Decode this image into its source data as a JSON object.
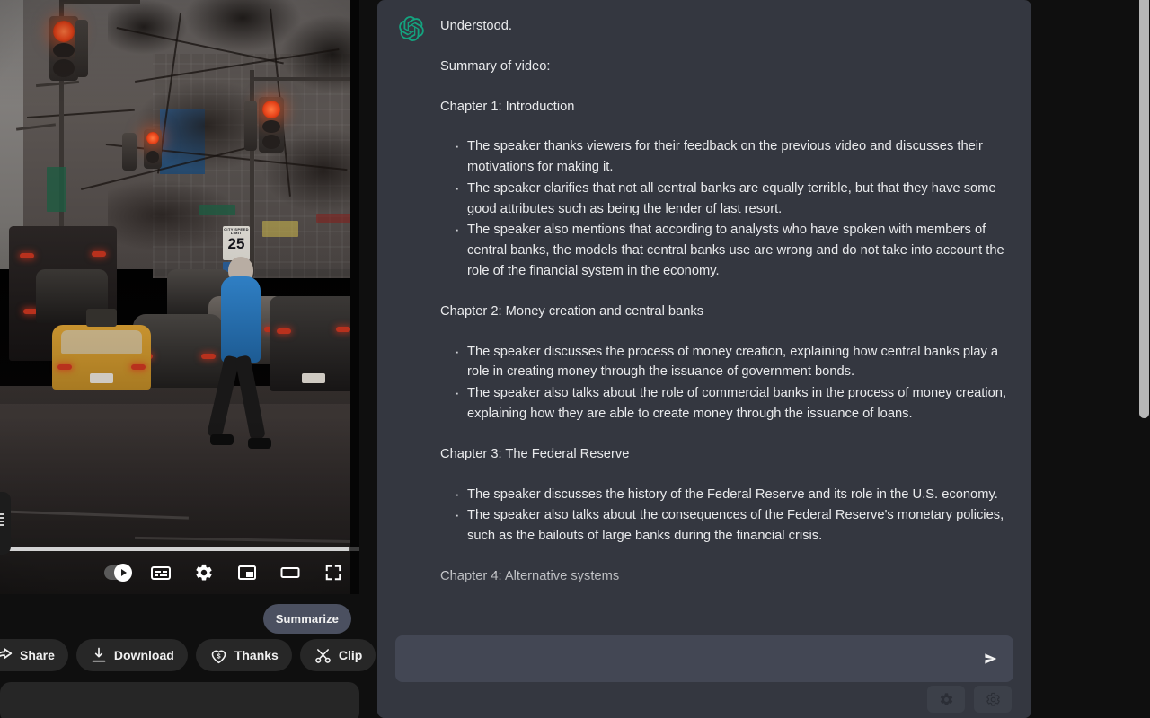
{
  "video_player": {
    "scene_description": "City street at dusk with traffic lights, line of cars including a yellow taxi, and a pedestrian in a blue jacket crossing",
    "speed_limit_sign": "25",
    "speed_limit_caption": "CITY SPEED LIMIT",
    "progress_percent": 97,
    "controls": [
      {
        "name": "autoplay-toggle",
        "label": "Autoplay",
        "state": "on"
      },
      {
        "name": "subtitles-button",
        "label": "Subtitles/closed captions"
      },
      {
        "name": "settings-button",
        "label": "Settings"
      },
      {
        "name": "miniplayer-button",
        "label": "Miniplayer"
      },
      {
        "name": "theater-button",
        "label": "Theater mode"
      },
      {
        "name": "fullscreen-button",
        "label": "Full screen"
      }
    ]
  },
  "summarize": {
    "label": "Summarize"
  },
  "actions": [
    {
      "name": "share",
      "label": "Share",
      "icon": "share-icon"
    },
    {
      "name": "download",
      "label": "Download",
      "icon": "download-icon"
    },
    {
      "name": "thanks",
      "label": "Thanks",
      "icon": "heart-dollar-icon"
    },
    {
      "name": "clip",
      "label": "Clip",
      "icon": "scissors-icon"
    },
    {
      "name": "more",
      "label": "",
      "icon": "more-horizontal-icon"
    }
  ],
  "chat": {
    "avatar_icon": "openai-logo-icon",
    "avatar_color": "#10a37f",
    "intro": "Understood.",
    "summary_heading": "Summary of video:",
    "chapters": [
      {
        "title": "Chapter 1: Introduction",
        "bullets": [
          "The speaker thanks viewers for their feedback on the previous video and discusses their motivations for making it.",
          "The speaker clarifies that not all central banks are equally terrible, but that they have some good attributes such as being the lender of last resort.",
          "The speaker also mentions that according to analysts who have spoken with members of central banks, the models that central banks use are wrong and do not take into account the role of the financial system in the economy."
        ]
      },
      {
        "title": "Chapter 2: Money creation and central banks",
        "bullets": [
          "The speaker discusses the process of money creation, explaining how central banks play a role in creating money through the issuance of government bonds.",
          "The speaker also talks about the role of commercial banks in the process of money creation, explaining how they are able to create money through the issuance of loans."
        ]
      },
      {
        "title": "Chapter 3: The Federal Reserve",
        "bullets": [
          "The speaker discusses the history of the Federal Reserve and its role in the U.S. economy.",
          "The speaker also talks about the consequences of the Federal Reserve's monetary policies, such as the bailouts of large banks during the financial crisis."
        ]
      },
      {
        "title": "Chapter 4: Alternative systems",
        "bullets": []
      }
    ]
  },
  "composer": {
    "input_value": "",
    "placeholder": "",
    "send_icon": "send-icon",
    "tools": [
      {
        "name": "settings-filled",
        "icon": "gear-filled-icon"
      },
      {
        "name": "settings-outline",
        "icon": "gear-outline-icon"
      }
    ]
  },
  "colors": {
    "page_background": "#0f0f0f",
    "chat_panel": "#343740",
    "composer_field": "#434754",
    "accent_green": "#10a37f",
    "summarize_button": "#4b5060",
    "chip_background": "#272727",
    "scrollbar_thumb": "#b6b6b6"
  }
}
